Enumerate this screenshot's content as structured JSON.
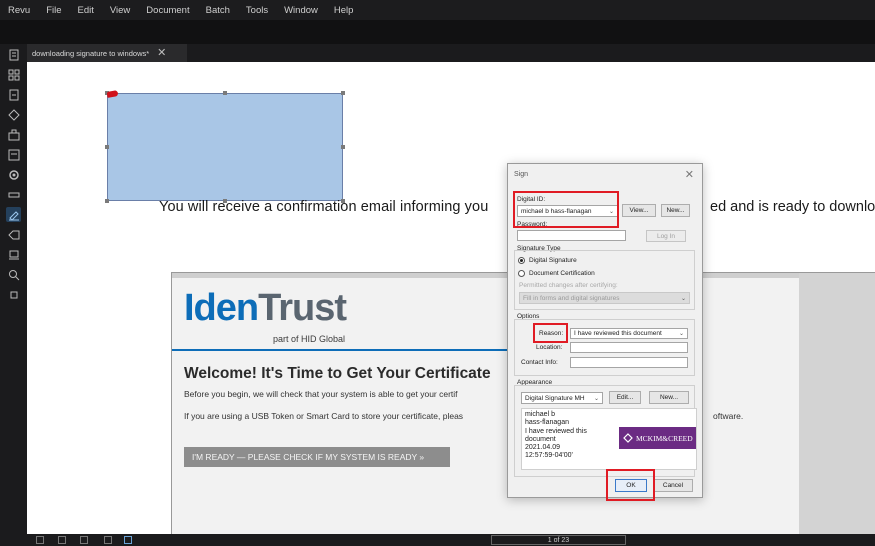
{
  "menu": [
    "Revu",
    "File",
    "Edit",
    "View",
    "Document",
    "Batch",
    "Tools",
    "Window",
    "Help"
  ],
  "tab": {
    "label": "downloading signature to windows*",
    "close": "✕"
  },
  "canvas": {
    "confirm_text": "You will receive a confirmation email informing you",
    "confirm_text_tail": "ed and is ready to downloa"
  },
  "identrust": {
    "logo_iden": "Iden",
    "logo_trust": "Trust",
    "sub": "part of HID Global",
    "welcome": "Welcome! It's Time to Get Your Certificate",
    "p1": "Before you begin, we will check that your system is able to get your certif",
    "p2": "If you are using a USB Token or Smart Card to store your certificate, pleas",
    "p2_tail": "oftware.",
    "button": "I'M READY — PLEASE CHECK IF MY SYSTEM IS READY »"
  },
  "dialog": {
    "title": "Sign",
    "close": "✕",
    "digital_id_label": "Digital ID:",
    "digital_id_value": "michael b hass-flanagan",
    "view_button": "View...",
    "new_button": "New...",
    "password_label": "Password:",
    "login_button": "Log In",
    "sig_type_label": "Signature Type",
    "opt_digital": "Digital Signature",
    "opt_cert": "Document Certification",
    "permitted_label": "Permitted changes after certifying:",
    "permitted_value": "Fill in forms and digital signatures",
    "options_label": "Options",
    "reason_label": "Reason:",
    "reason_value": "I have reviewed this document",
    "location_label": "Location:",
    "contact_label": "Contact Info:",
    "appearance_label": "Appearance",
    "appearance_value": "Digital Signature MH",
    "edit_button": "Edit...",
    "new2_button": "New...",
    "preview_text": "michael b\nhass-flanagan\nI have reviewed this\ndocument\n2021.04.09\n12:57:59-04'00'",
    "preview_logo": "MCKIM&CREED",
    "ok_button": "OK",
    "cancel_button": "Cancel"
  },
  "bottombar": {
    "pager": "1 of 23"
  },
  "colors": {
    "highlight": "#e01b24",
    "markup_fill": "#a9c6e6",
    "identrust_blue": "#0d6db8"
  }
}
